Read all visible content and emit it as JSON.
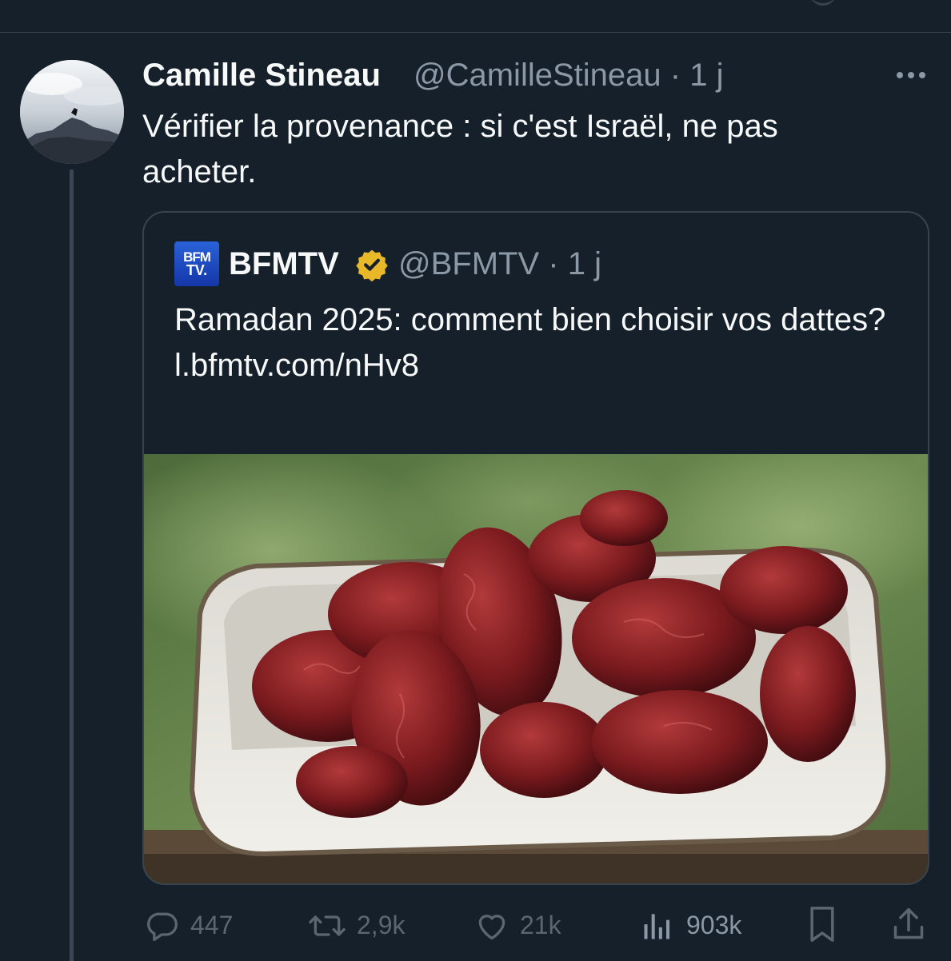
{
  "tweet": {
    "author_name": "Camille Stineau",
    "author_handle": "@CamilleStineau",
    "separator": "·",
    "time": "1 j",
    "text": "Vérifier la provenance : si c'est Israël, ne pas acheter."
  },
  "quoted_tweet": {
    "logo_text_top": "BFM",
    "logo_text_bottom": "TV.",
    "author_name": "BFMTV",
    "author_handle": "@BFMTV",
    "separator": "·",
    "time": "1 j",
    "text_line": "Ramadan 2025: comment bien choisir vos dattes?",
    "link": "l.bfmtv.com/nHv8"
  },
  "actions": {
    "replies": "447",
    "reposts": "2,9k",
    "likes": "21k",
    "views": "903k"
  },
  "icons": {
    "more": "more-horizontal-icon",
    "verified": "verified-badge-icon",
    "reply": "reply-icon",
    "repost": "repost-icon",
    "like": "heart-icon",
    "views": "bar-chart-icon",
    "bookmark": "bookmark-icon",
    "share": "share-icon"
  },
  "colors": {
    "background": "#15202b",
    "text_primary": "#f7f9f9",
    "text_secondary": "#8b98a5",
    "border": "#38444d",
    "verified_gold": "#e8b829",
    "bfm_blue": "#1f4fc7"
  }
}
